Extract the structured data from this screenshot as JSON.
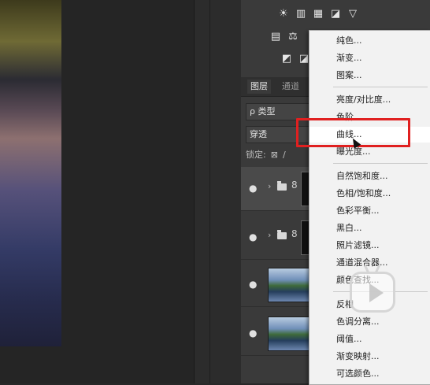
{
  "panel": {
    "tabs": [
      "图层",
      "通道"
    ],
    "kind_label": "ρ 类型",
    "blend_mode": "穿透",
    "lock_label": "锁定:",
    "top_icons_row1": [
      "☀",
      "▥",
      "▦",
      "◪",
      "▽"
    ],
    "top_icons_row2": [
      "▤",
      "⚖"
    ],
    "top_icons_row3": [
      "◩",
      "◪"
    ]
  },
  "layers": [
    {
      "type": "group",
      "selected": true
    },
    {
      "type": "group",
      "selected": false
    },
    {
      "type": "image",
      "selected": false
    },
    {
      "type": "image",
      "selected": false
    }
  ],
  "menu": {
    "items": [
      "纯色...",
      "渐变...",
      "图案...",
      "亮度/对比度...",
      "色阶...",
      "曲线...",
      "曝光度...",
      "自然饱和度...",
      "色相/饱和度...",
      "色彩平衡...",
      "黑白...",
      "照片滤镜...",
      "通道混合器...",
      "颜色查找...",
      "反相",
      "色调分离...",
      "阈值...",
      "渐变映射...",
      "可选颜色..."
    ],
    "highlighted": "曲线..."
  },
  "colors": {
    "highlight_box": "#e02020",
    "menu_bg": "#f2f2f2",
    "panel_bg": "#3a3a3a"
  }
}
